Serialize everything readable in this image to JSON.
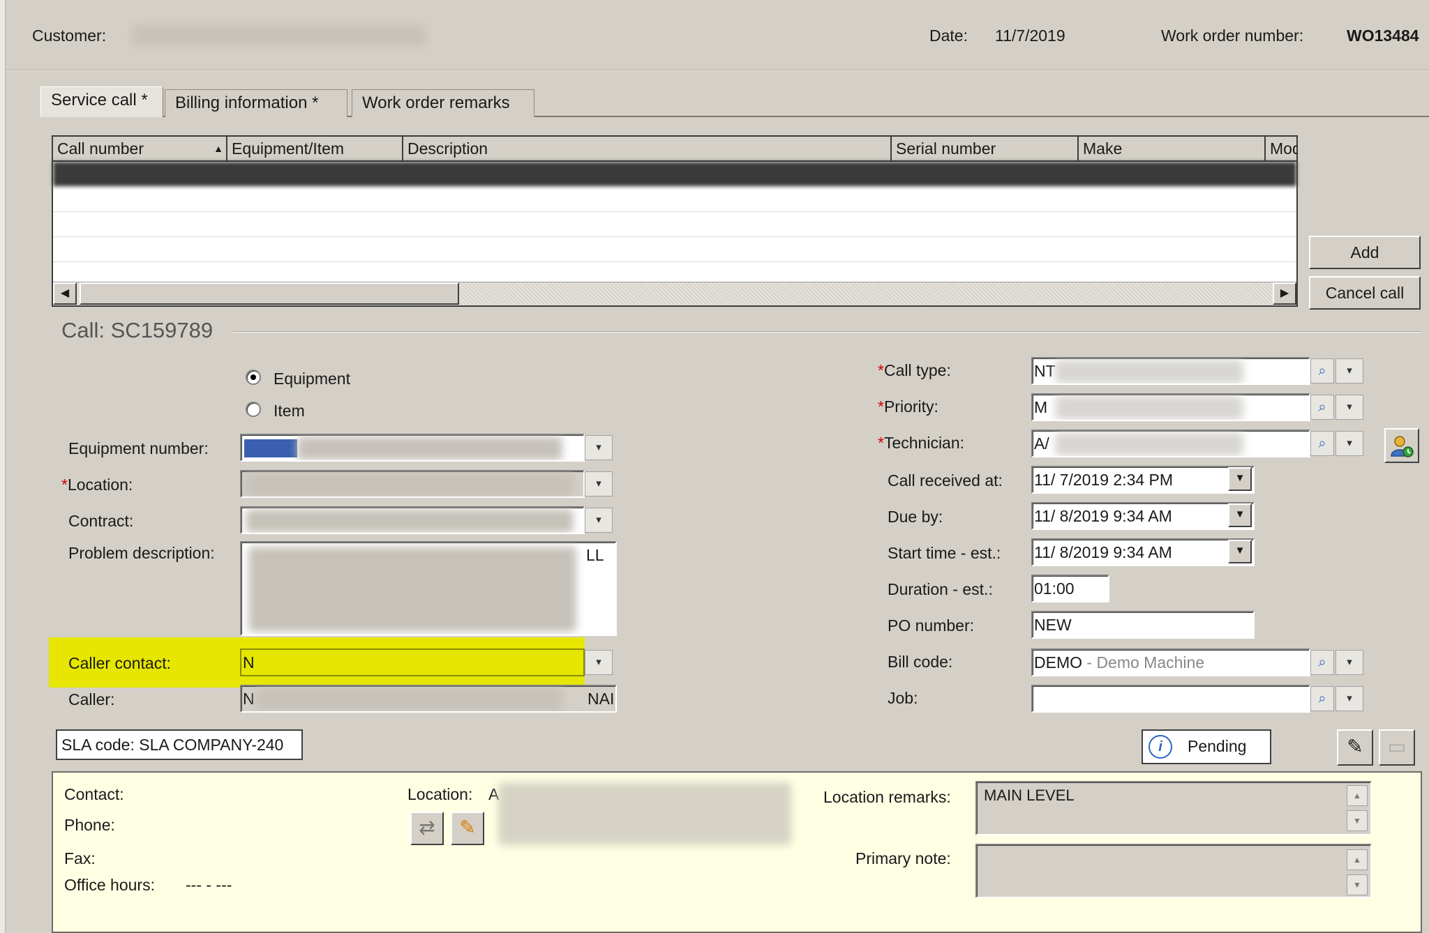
{
  "header": {
    "customer_label": "Customer:",
    "date_label": "Date:",
    "date_value": "11/7/2019",
    "wo_label": "Work order number:",
    "wo_value": "WO13484"
  },
  "tabs": [
    {
      "label": "Service call *",
      "active": true
    },
    {
      "label": "Billing information *",
      "active": false
    },
    {
      "label": "Work order remarks",
      "active": false
    }
  ],
  "grid": {
    "columns": [
      "Call number",
      "Equipment/Item",
      "Description",
      "Serial number",
      "Make",
      "Model"
    ],
    "sort_indicator": "▲"
  },
  "buttons": {
    "add": "Add",
    "cancel_call": "Cancel call",
    "pending": "Pending"
  },
  "call": {
    "title": "Call: SC159789",
    "radio_equipment": "Equipment",
    "radio_item": "Item",
    "equipment_selected": true
  },
  "left_fields": {
    "equipment_number": "Equipment number:",
    "location": "Location:",
    "contract": "Contract:",
    "problem_description": "Problem description:",
    "caller_contact": "Caller contact:",
    "caller": "Caller:",
    "problem_fragment": "LL",
    "caller_contact_prefix": "N",
    "caller_prefix": "N",
    "caller_suffix": "NAI"
  },
  "right_fields": {
    "call_type_label": "Call type:",
    "call_type_value": "NT",
    "priority_label": "Priority:",
    "priority_value": "M",
    "technician_label": "Technician:",
    "technician_value": "A/",
    "call_received_label": "Call received at:",
    "call_received_value": "11/ 7/2019   2:34 PM",
    "due_by_label": "Due by:",
    "due_by_value": "11/ 8/2019   9:34 AM",
    "start_time_label": "Start time - est.:",
    "start_time_value": "11/ 8/2019   9:34 AM",
    "duration_label": "Duration - est.:",
    "duration_value": "01:00",
    "po_label": "PO number:",
    "po_value": "NEW",
    "bill_code_label": "Bill code:",
    "bill_code_value": "DEMO",
    "bill_code_desc": " - Demo Machine",
    "job_label": "Job:",
    "job_value": ""
  },
  "sla": "SLA code: SLA COMPANY-240",
  "info_panel": {
    "contact_label": "Contact:",
    "phone_label": "Phone:",
    "fax_label": "Fax:",
    "office_hours_label": "Office hours:",
    "office_hours_value": "--- - ---",
    "location_label": "Location:",
    "location_prefix": "A",
    "location_remarks_label": "Location remarks:",
    "location_remarks_value": "MAIN LEVEL",
    "primary_note_label": "Primary note:",
    "primary_note_value": ""
  },
  "colors": {
    "highlight": "#e6e600",
    "required": "#d00000",
    "info_panel_bg": "#ffffe4"
  }
}
